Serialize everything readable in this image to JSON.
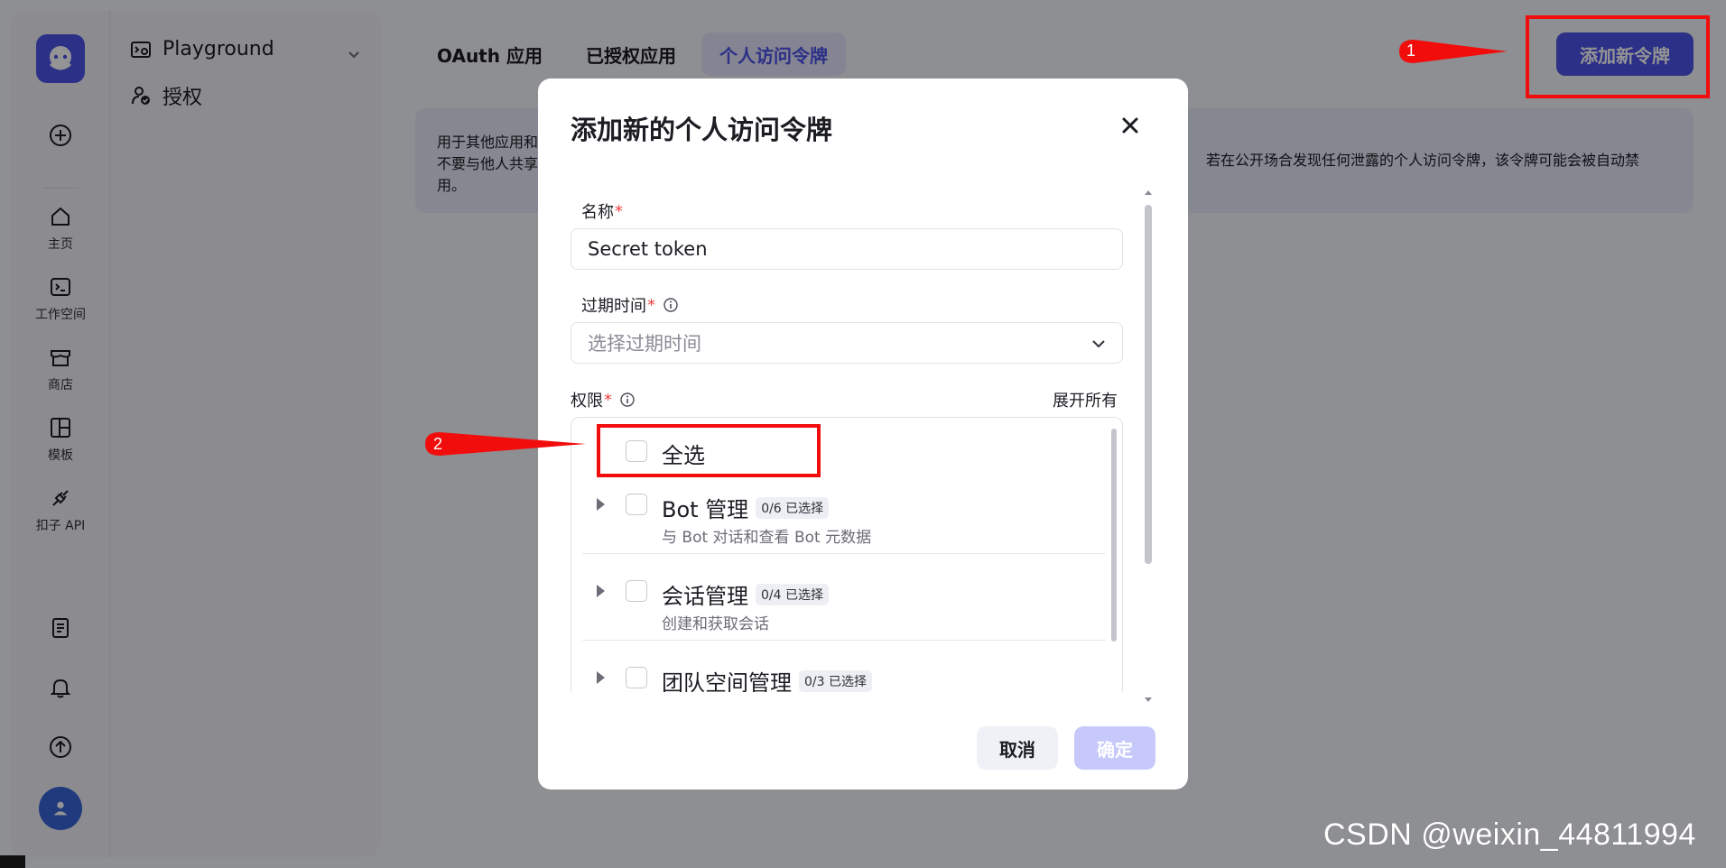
{
  "rail": {
    "items": [
      {
        "icon": "home-icon",
        "label": "主页"
      },
      {
        "icon": "workspace-icon",
        "label": "工作空间"
      },
      {
        "icon": "store-icon",
        "label": "商店"
      },
      {
        "icon": "template-icon",
        "label": "模板"
      },
      {
        "icon": "api-plug-icon",
        "label": "扣子 API"
      }
    ]
  },
  "subnav": {
    "playground": "Playground",
    "auth": "授权"
  },
  "header": {
    "tabs": [
      "OAuth 应用",
      "已授权应用",
      "个人访问令牌"
    ],
    "active_tab": "个人访问令牌",
    "add_button": "添加新令牌"
  },
  "banner": {
    "line1": "用于其他应用和",
    "line2_left": "不要与他人共享",
    "line2_right": "若在公开场合发现任何泄露的个人访问令牌，该令牌可能会被自动禁",
    "line3": "用。"
  },
  "dialog": {
    "title": "添加新的个人访问令牌",
    "name_label": "名称",
    "name_value": "Secret token",
    "expiry_label": "过期时间",
    "expiry_placeholder": "选择过期时间",
    "perm_label": "权限",
    "required_mark": "*",
    "expand_all": "展开所有",
    "select_all": "全选",
    "permissions": [
      {
        "name": "Bot 管理",
        "badge": "0/6 已选择",
        "desc": "与 Bot 对话和查看 Bot 元数据"
      },
      {
        "name": "会话管理",
        "badge": "0/4 已选择",
        "desc": "创建和获取会话"
      },
      {
        "name": "团队空间管理",
        "badge": "0/3 已选择",
        "desc": ""
      }
    ],
    "cancel": "取消",
    "confirm": "确定"
  },
  "annotations": {
    "step1": "1",
    "step2": "2"
  },
  "watermark": "CSDN @weixin_44811994",
  "colors": {
    "accent": "#4d53e8",
    "annotation": "#f20d0d"
  }
}
